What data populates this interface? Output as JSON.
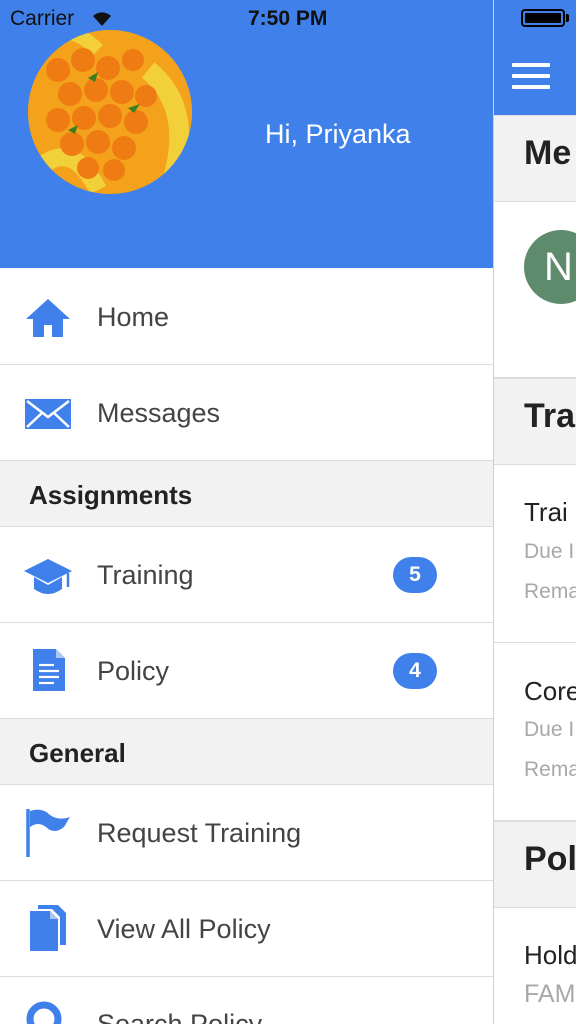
{
  "status_bar": {
    "carrier": "Carrier",
    "time": "7:50 PM"
  },
  "header": {
    "greeting": "Hi, Priyanka",
    "background_color": "#3f80ea"
  },
  "menu": {
    "items": [
      {
        "label": "Home",
        "icon": "home-icon"
      },
      {
        "label": "Messages",
        "icon": "envelope-icon"
      }
    ],
    "sections": [
      {
        "title": "Assignments",
        "items": [
          {
            "label": "Training",
            "icon": "graduation-cap-icon",
            "badge": "5"
          },
          {
            "label": "Policy",
            "icon": "document-icon",
            "badge": "4"
          }
        ]
      },
      {
        "title": "General",
        "items": [
          {
            "label": "Request Training",
            "icon": "flag-icon"
          },
          {
            "label": "View All Policy",
            "icon": "documents-icon"
          },
          {
            "label": "Search Policy",
            "icon": "search-icon"
          }
        ]
      }
    ]
  },
  "background_page": {
    "sections": [
      "Me",
      "Tra",
      "Pol"
    ],
    "avatar_initial": "N",
    "items": [
      {
        "title": "Trai",
        "due": "Due I",
        "remaining": "Rema"
      },
      {
        "title": "Core",
        "due": "Due I",
        "remaining": "Rema"
      }
    ],
    "policy_item": {
      "title": "Hold",
      "subtitle": "FAM"
    }
  },
  "colors": {
    "accent": "#3f80ea",
    "section_background": "#f2f2f2",
    "divider": "#dcdcdc"
  }
}
